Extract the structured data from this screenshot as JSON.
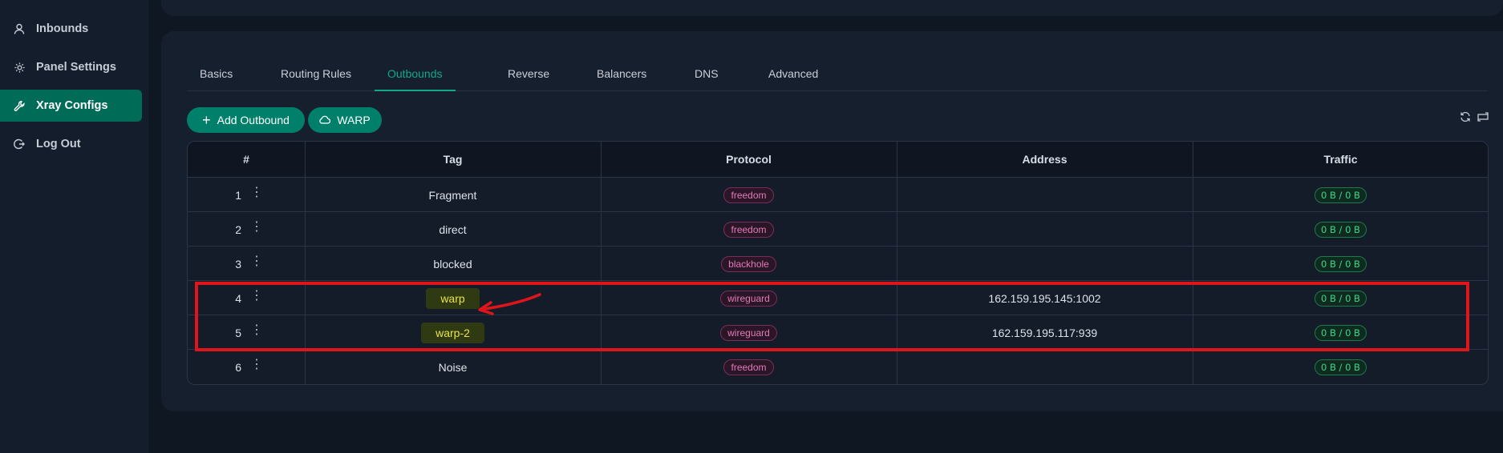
{
  "sidebar": {
    "items": [
      {
        "label": "Inbounds",
        "icon": "user-icon",
        "active": false
      },
      {
        "label": "Panel Settings",
        "icon": "gear-icon",
        "active": false
      },
      {
        "label": "Xray Configs",
        "icon": "wrench-icon",
        "active": true
      },
      {
        "label": "Log Out",
        "icon": "logout-icon",
        "active": false
      }
    ]
  },
  "tabs": [
    {
      "label": "Basics",
      "active": false
    },
    {
      "label": "Routing Rules",
      "active": false
    },
    {
      "label": "Outbounds",
      "active": true
    },
    {
      "label": "Reverse",
      "active": false
    },
    {
      "label": "Balancers",
      "active": false
    },
    {
      "label": "DNS",
      "active": false
    },
    {
      "label": "Advanced",
      "active": false
    }
  ],
  "toolbar": {
    "add_outbound_label": "Add Outbound",
    "warp_label": "WARP",
    "refresh_icon": "refresh-icon",
    "resize_icon": "expand-icon"
  },
  "table": {
    "headers": [
      "#",
      "Tag",
      "Protocol",
      "Address",
      "Traffic"
    ],
    "rows": [
      {
        "num": "1",
        "tag": "Fragment",
        "protocol": "freedom",
        "address": "",
        "traffic": "0 B / 0 B"
      },
      {
        "num": "2",
        "tag": "direct",
        "protocol": "freedom",
        "address": "",
        "traffic": "0 B / 0 B"
      },
      {
        "num": "3",
        "tag": "blocked",
        "protocol": "blackhole",
        "address": "",
        "traffic": "0 B / 0 B"
      },
      {
        "num": "4",
        "tag": "warp",
        "protocol": "wireguard",
        "address": "162.159.195.145:1002",
        "traffic": "0 B / 0 B",
        "highlighted": true
      },
      {
        "num": "5",
        "tag": "warp-2",
        "protocol": "wireguard",
        "address": "162.159.195.117:939",
        "traffic": "0 B / 0 B",
        "highlighted": true
      },
      {
        "num": "6",
        "tag": "Noise",
        "protocol": "freedom",
        "address": "",
        "traffic": "0 B / 0 B"
      }
    ]
  },
  "colors": {
    "accent": "#00806a",
    "active_tab": "#12a888",
    "annotation_red": "#e0141b",
    "highlight_text": "#e8e24a"
  }
}
